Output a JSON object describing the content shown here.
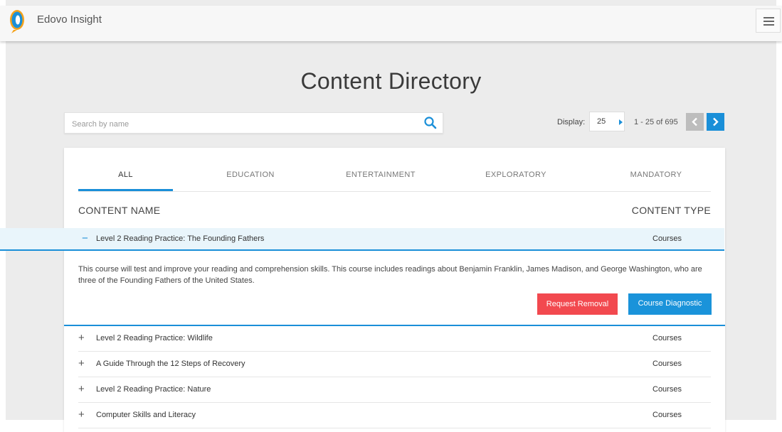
{
  "app": {
    "brand": "Edovo Insight"
  },
  "page": {
    "title": "Content Directory"
  },
  "search": {
    "placeholder": "Search by name",
    "value": ""
  },
  "pagination": {
    "display_label": "Display:",
    "display_value": "25",
    "range_text": "1 - 25 of 695"
  },
  "tabs": [
    {
      "label": "ALL",
      "active": true
    },
    {
      "label": "EDUCATION",
      "active": false
    },
    {
      "label": "ENTERTAINMENT",
      "active": false
    },
    {
      "label": "EXPLORATORY",
      "active": false
    },
    {
      "label": "MANDATORY",
      "active": false
    }
  ],
  "table": {
    "col_name": "CONTENT NAME",
    "col_type": "CONTENT TYPE"
  },
  "expanded_item": {
    "toggle": "−",
    "title": "Level 2 Reading Practice: The Founding Fathers",
    "type": "Courses",
    "description": "This course will test and improve your reading and comprehension skills. This course includes readings about Benjamin Franklin, James Madison, and George Washington, who are three of the Founding Fathers of the United States.",
    "remove_label": "Request Removal",
    "diagnostic_label": "Course Diagnostic"
  },
  "items": [
    {
      "toggle": "+",
      "title": "Level 2 Reading Practice: Wildlife",
      "type": "Courses"
    },
    {
      "toggle": "+",
      "title": "A Guide Through the 12 Steps of Recovery",
      "type": "Courses"
    },
    {
      "toggle": "+",
      "title": "Level 2 Reading Practice: Nature",
      "type": "Courses"
    },
    {
      "toggle": "+",
      "title": "Computer Skills and Literacy",
      "type": "Courses"
    }
  ],
  "colors": {
    "accent": "#1a8fd8",
    "danger": "#f2494f",
    "logo_blue": "#1a8fd8",
    "logo_orange": "#f5a21b"
  }
}
